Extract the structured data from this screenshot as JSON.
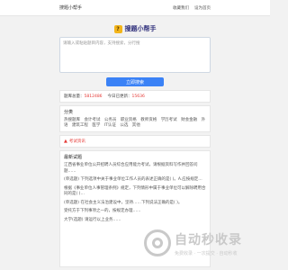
{
  "topbar": {
    "site_name": "搜题小帮手",
    "link_1": "收藏我们",
    "link_2": "设为首页"
  },
  "brand": {
    "title": "搜题小帮手"
  },
  "search": {
    "placeholder": "请输入或粘贴题目内容，支持搜索，分行搜",
    "button_label": "立即搜索"
  },
  "stats": {
    "total_label": "题库总量：",
    "total_value": "5812486",
    "today_label": "今日已更新：",
    "today_value": "15636"
  },
  "categories": {
    "heading": "分类",
    "tags": [
      "热搜题库",
      "会计考试",
      "公务员",
      "职业资格",
      "教师资格",
      "学历考试",
      "财会金融",
      "外语",
      "建筑工程",
      "医学",
      "IT认证",
      "公选",
      "其他"
    ]
  },
  "notice": {
    "label": "考试资讯"
  },
  "latest": {
    "heading": "最新试题",
    "items": [
      "江西省事业单位公开招聘人员综合应用能力考试，请根据资料写作并回答问题……",
      "(单选题) 下列选项中关于事业单位工作人员的表述正确的是( )。A.应按规定…",
      "根据《事业单位人事管理条例》规定，下列情形中属于事业单位可以解除聘用合同的是( )…",
      "(单选题) 在社会主义法治建设中，坚持……下列说法正确的是( )。",
      "受托方于下列事项之一的，按规定办理……",
      "大学(选题) 请运行以上业务……"
    ]
  },
  "watermark": {
    "title": "自动秒收录",
    "subtitle": "免费收录 · 一次提交 · 自动秒收"
  }
}
